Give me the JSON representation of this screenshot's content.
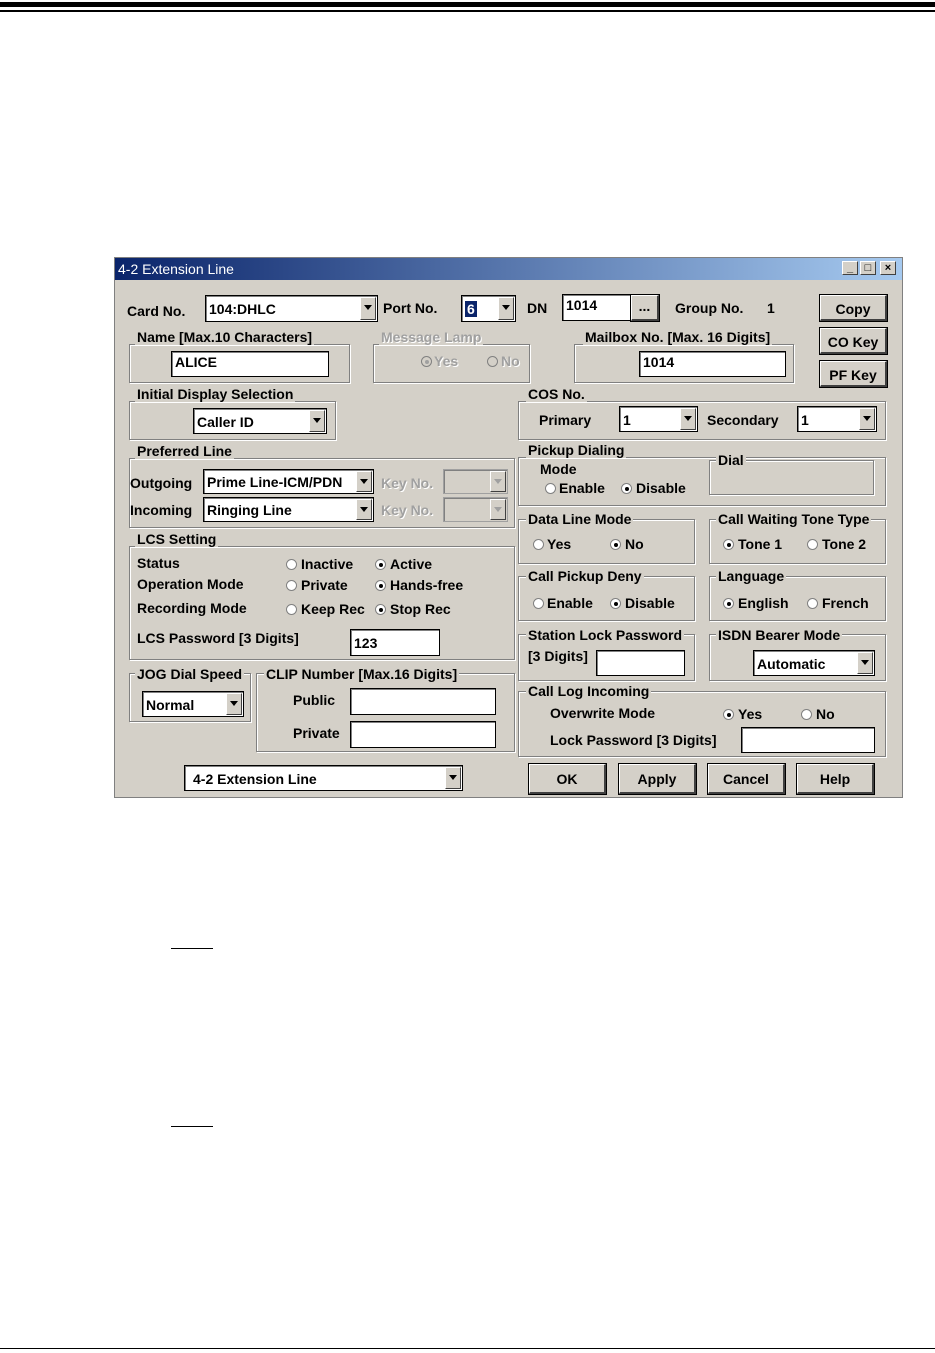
{
  "window": {
    "title": "4-2 Extension Line"
  },
  "row1": {
    "card_label": "Card No.",
    "card_value": "104:DHLC",
    "port_label": "Port No.",
    "port_value": "6",
    "dn_label": "DN",
    "dn_value": "1014",
    "dn_browse": "...",
    "group_label": "Group No.",
    "group_value": "1",
    "copy": "Copy"
  },
  "name": {
    "legend": "Name [Max.10 Characters]",
    "value": "ALICE"
  },
  "message_lamp": {
    "legend": "Message Lamp",
    "yes": "Yes",
    "no": "No"
  },
  "mailbox": {
    "legend": "Mailbox No. [Max. 16 Digits]",
    "value": "1014"
  },
  "side_buttons": {
    "co_key": "CO Key",
    "pf_key": "PF Key"
  },
  "initial_display": {
    "legend": "Initial Display Selection",
    "value": "Caller ID"
  },
  "cos": {
    "legend": "COS No.",
    "primary_label": "Primary",
    "primary_value": "1",
    "secondary_label": "Secondary",
    "secondary_value": "1"
  },
  "preferred_line": {
    "legend": "Preferred Line",
    "outgoing_label": "Outgoing",
    "outgoing_value": "Prime Line-ICM/PDN",
    "incoming_label": "Incoming",
    "incoming_value": "Ringing Line",
    "key_no_label": "Key No."
  },
  "pickup": {
    "legend": "Pickup Dialing",
    "mode_label": "Mode",
    "enable": "Enable",
    "disable": "Disable",
    "dial_legend": "Dial"
  },
  "data_line": {
    "legend": "Data Line Mode",
    "yes": "Yes",
    "no": "No"
  },
  "cw_tone": {
    "legend": "Call Waiting Tone Type",
    "tone1": "Tone 1",
    "tone2": "Tone 2"
  },
  "lcs": {
    "legend": "LCS Setting",
    "status_label": "Status",
    "inactive": "Inactive",
    "active": "Active",
    "op_label": "Operation Mode",
    "private": "Private",
    "handsfree": "Hands-free",
    "rec_label": "Recording Mode",
    "keep_rec": "Keep Rec",
    "stop_rec": "Stop Rec",
    "password_label": "LCS Password [3 Digits]",
    "password_value": "123"
  },
  "pickup_deny": {
    "legend": "Call Pickup Deny",
    "enable": "Enable",
    "disable": "Disable"
  },
  "language": {
    "legend": "Language",
    "english": "English",
    "french": "French"
  },
  "station_lock": {
    "legend": "Station Lock Password",
    "sub": "[3 Digits]"
  },
  "isdn": {
    "legend": "ISDN Bearer Mode",
    "value": "Automatic"
  },
  "jog": {
    "legend": "JOG Dial Speed",
    "value": "Normal"
  },
  "clip": {
    "legend": "CLIP Number [Max.16 Digits]",
    "public": "Public",
    "private": "Private"
  },
  "call_log": {
    "legend": "Call Log Incoming",
    "overwrite_label": "Overwrite Mode",
    "yes": "Yes",
    "no": "No",
    "lock_label": "Lock Password [3 Digits]"
  },
  "footer": {
    "screen_select": "4-2 Extension Line",
    "ok": "OK",
    "apply": "Apply",
    "cancel": "Cancel",
    "help": "Help"
  }
}
